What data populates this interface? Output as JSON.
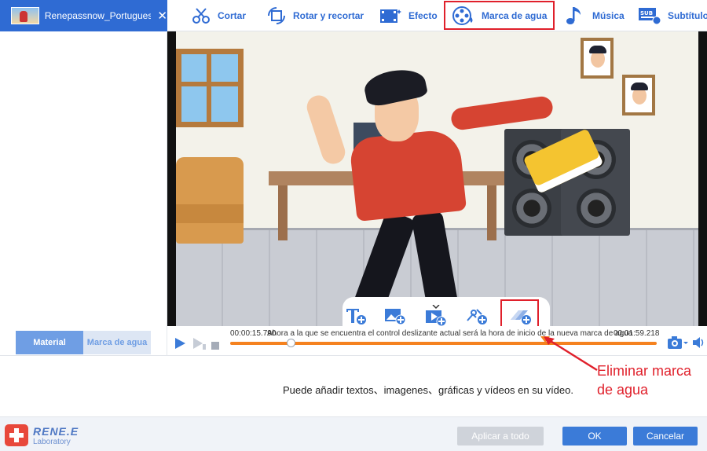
{
  "file_tab": {
    "name": "Renepassnow_Portugues...",
    "close": "✕"
  },
  "toolbar": {
    "items": [
      {
        "label": "Cortar",
        "icon": "cut-icon"
      },
      {
        "label": "Rotar y recortar",
        "icon": "rotate-crop-icon"
      },
      {
        "label": "Efecto",
        "icon": "effect-icon"
      },
      {
        "label": "Marca de agua",
        "icon": "watermark-icon",
        "active": true
      },
      {
        "label": "Música",
        "icon": "music-icon"
      },
      {
        "label": "Subtítulo",
        "icon": "subtitle-icon"
      }
    ]
  },
  "left_panel": {
    "tabs": [
      {
        "label": "Material",
        "active": true
      },
      {
        "label": "Marca de agua",
        "active": false
      }
    ]
  },
  "watermark_tools": {
    "items": [
      "add-text-icon",
      "add-image-icon",
      "add-video-icon",
      "add-shape-icon",
      "remove-watermark-icon"
    ]
  },
  "timeline": {
    "current_time": "00:00:15.790",
    "end_time": "00:01:59.218",
    "hint": "Ahora a la que se encuentra el control deslizante actual será la hora de inicio de la nueva marca de agua",
    "progress": 0.13
  },
  "info": {
    "message": "Puede añadir textos、imagenes、gráficas y vídeos en su vídeo."
  },
  "annotation": {
    "line1": "Eliminar marca",
    "line2": "de agua",
    "color": "#e0202b"
  },
  "logo": {
    "main": "RENE.E",
    "sub": "Laboratory"
  },
  "buttons": {
    "apply_all": "Aplicar a todo",
    "ok": "OK",
    "cancel": "Cancelar"
  },
  "colors": {
    "accent": "#2f6bd3",
    "progress": "#f5821f",
    "highlight": "#e0202b"
  }
}
